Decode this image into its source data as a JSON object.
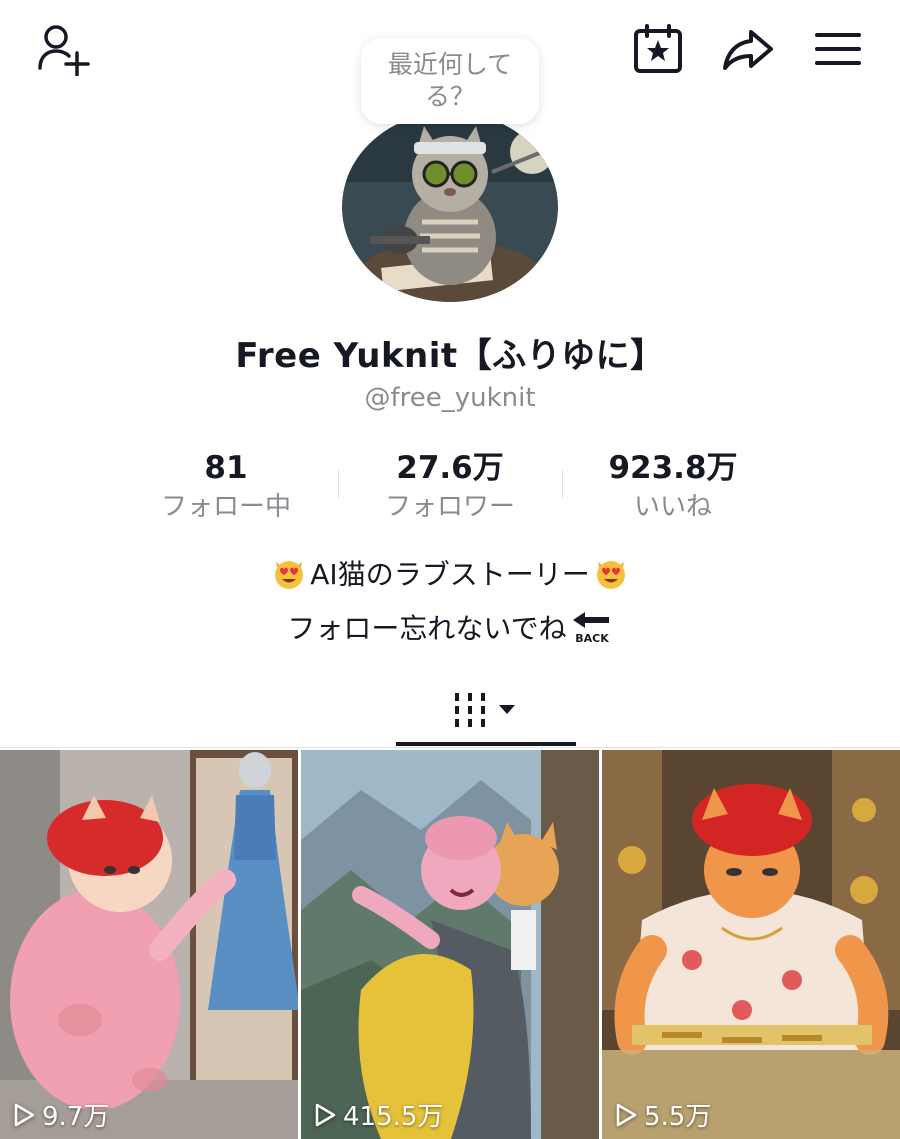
{
  "status_prompt": "最近何してる？",
  "profile": {
    "display_name": "Free Yuknit【ふりゆに】",
    "handle": "@free_yuknit"
  },
  "stats": [
    {
      "value": "81",
      "label": "フォロー中"
    },
    {
      "value": "27.6万",
      "label": "フォロワー"
    },
    {
      "value": "923.8万",
      "label": "いいね"
    }
  ],
  "bio": {
    "line1": "AI猫のラブストーリー",
    "line2": "フォロー忘れないでね",
    "back_badge": "BACK"
  },
  "icons": {
    "top_left": "add-friend-icon",
    "top_right": [
      "calendar-star-icon",
      "share-icon",
      "menu-icon"
    ],
    "tab": "video-grid-icon",
    "views": "play-icon",
    "bio_emoji": "heart-eyes-cat-emoji"
  },
  "videos": [
    {
      "views": "9.7万"
    },
    {
      "views": "415.5万"
    },
    {
      "views": "5.5万"
    }
  ],
  "colors": {
    "text": "#161823",
    "secondary": "#8a8b91",
    "divider": "#e3e3e4"
  }
}
